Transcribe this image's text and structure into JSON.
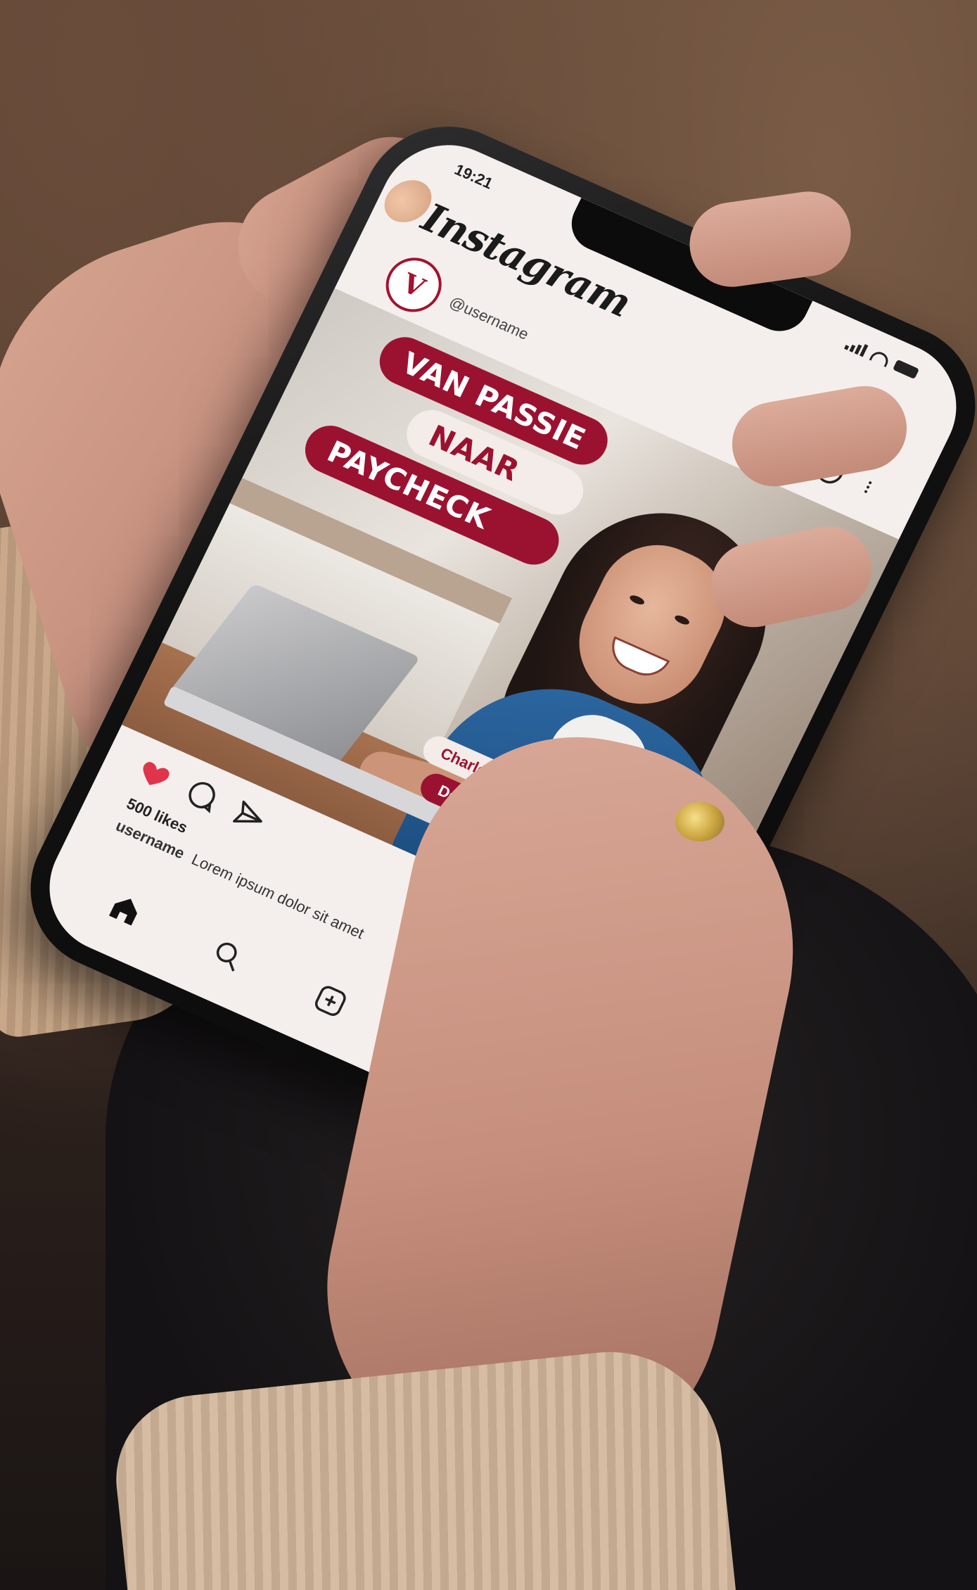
{
  "status_bar": {
    "time": "19:21"
  },
  "app": {
    "logo_text": "Instagram"
  },
  "post": {
    "avatar_letter": "V",
    "handle": "@username",
    "headline_lines": [
      "VAN PASSIE",
      "NAAR",
      "PAYCHECK"
    ],
    "badge_name": "Charlotte",
    "badge_role": "Developer",
    "likes": "500 likes",
    "caption_user": "username",
    "caption_text": "Lorem ipsum dolor sit amet"
  },
  "icons": {
    "header": [
      "heart-icon",
      "messenger-icon",
      "more-icon"
    ],
    "actions": [
      "heart-filled-icon",
      "comment-icon",
      "share-icon",
      "bookmark-icon"
    ],
    "tabbar": [
      "home-icon",
      "search-icon",
      "add-post-icon",
      "shop-icon",
      "profile-icon"
    ]
  },
  "colors": {
    "brand_red": "#9b1230",
    "cream": "#f3ece8",
    "like_red": "#e0344a"
  }
}
